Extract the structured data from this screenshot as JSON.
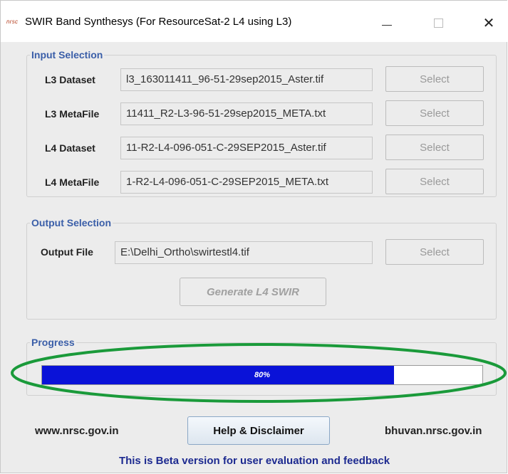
{
  "window": {
    "logo_text": "nrsc",
    "title": "SWIR Band Synthesys (For ResourceSat-2 L4 using L3)",
    "close_glyph": "✕"
  },
  "input_selection": {
    "title": "Input Selection",
    "rows": [
      {
        "label": "L3 Dataset",
        "value": "l3_163011411_96-51-29sep2015_Aster.tif",
        "button": "Select"
      },
      {
        "label": "L3 MetaFile",
        "value": "11411_R2-L3-96-51-29sep2015_META.txt",
        "button": "Select"
      },
      {
        "label": "L4 Dataset",
        "value": "11-R2-L4-096-051-C-29SEP2015_Aster.tif",
        "button": "Select"
      },
      {
        "label": "L4 MetaFile",
        "value": "1-R2-L4-096-051-C-29SEP2015_META.txt",
        "button": "Select"
      }
    ]
  },
  "output_selection": {
    "title": "Output Selection",
    "label": "Output File",
    "value": "E:\\Delhi_Ortho\\swirtestl4.tif",
    "button": "Select",
    "generate_button": "Generate L4 SWIR"
  },
  "progress": {
    "title": "Progress",
    "value": 0.8,
    "text": "80%",
    "bar_color": "#0a12d8",
    "highlight_color": "#1a9a3a"
  },
  "footer": {
    "left_link": "www.nrsc.gov.in",
    "help_button": "Help & Disclaimer",
    "right_link": "bhuvan.nrsc.gov.in",
    "beta_notice": "This is Beta version for user evaluation and feedback"
  }
}
